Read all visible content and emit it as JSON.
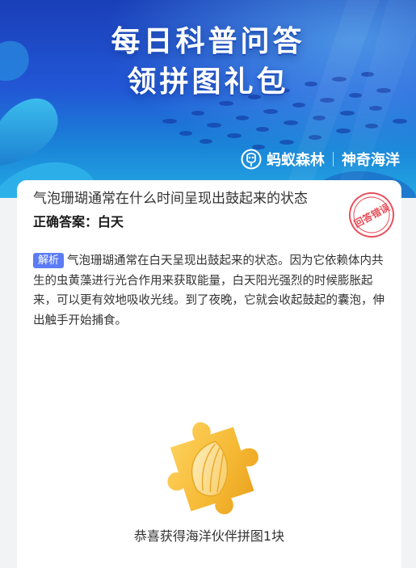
{
  "banner": {
    "title_line1": "每日科普问答",
    "title_line2": "领拼图礼包",
    "brand_name": "蚂蚁森林",
    "brand_sub": "神奇海洋"
  },
  "card": {
    "question": "气泡珊瑚通常在什么时间呈现出鼓起来的状态",
    "answer": "正确答案：白天",
    "stamp_text": "回答错误",
    "analysis_tag": "解析",
    "analysis_text": "气泡珊瑚通常在白天呈现出鼓起来的状态。因为它依赖体内共生的虫黄藻进行光合作用来获取能量，白天阳光强烈的时候膨胀起来，可以更有效地吸收光线。到了夜晚，它就会收起鼓起的囊泡，伸出触手开始捕食。",
    "reward_text": "恭喜获得海洋伙伴拼图1块"
  },
  "colors": {
    "banner_blue": "#2257d6",
    "tag_blue": "#5b7cf5",
    "stamp_red": "#e8505b",
    "puzzle_gold": "#f5b731"
  },
  "icons": {
    "brand_logo": "ant-forest-icon",
    "reward": "puzzle-piece-icon"
  }
}
